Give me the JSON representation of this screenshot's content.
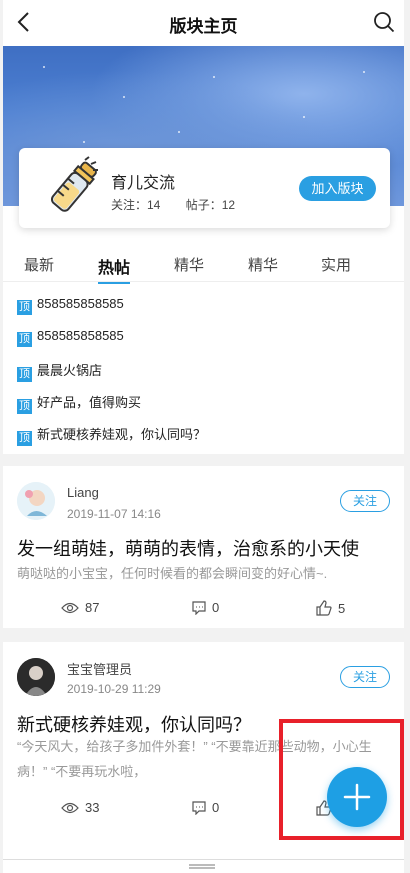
{
  "header": {
    "title": "版块主页",
    "back_icon": "back-chevron-icon",
    "search_icon": "search-icon"
  },
  "board": {
    "name": "育儿交流",
    "follow_label": "关注：14",
    "posts_label": "帖子：12",
    "join_label": "加入版块",
    "icon": "baby-bottle-icon"
  },
  "tabs": [
    {
      "label": "最新",
      "active": false
    },
    {
      "label": "热帖",
      "active": true
    },
    {
      "label": "精华",
      "active": false
    },
    {
      "label": "精华",
      "active": false
    },
    {
      "label": "实用",
      "active": false
    }
  ],
  "pinned_badge": "顶",
  "pinned": [
    {
      "text": "858585858585"
    },
    {
      "text": "858585858585"
    },
    {
      "text": "晨晨火锅店"
    },
    {
      "text": "好产品，值得购买"
    },
    {
      "text": "新式硬核养娃观，你认同吗？"
    }
  ],
  "posts": [
    {
      "author": "Liang",
      "time": "2019-11-07 14:16",
      "follow": "关注",
      "title": "发一组萌娃，萌萌的表情，治愈系的小天使",
      "excerpt": "萌哒哒的小宝宝，任何时候看的都会瞬间变的好心情~.",
      "views": "87",
      "comments": "0",
      "likes": "5"
    },
    {
      "author": "宝宝管理员",
      "time": "2019-10-29 11:29",
      "follow": "关注",
      "title": "新式硬核养娃观，你认同吗？",
      "excerpt": "“今天风大，给孩子多加件外套！” “不要靠近那些动物，小心生病！” “不要再玩水啦，",
      "views": "33",
      "comments": "0",
      "likes": ""
    }
  ],
  "fab": {
    "icon": "plus-icon"
  },
  "colors": {
    "accent": "#2a9fe2",
    "highlight": "#e8202a"
  }
}
